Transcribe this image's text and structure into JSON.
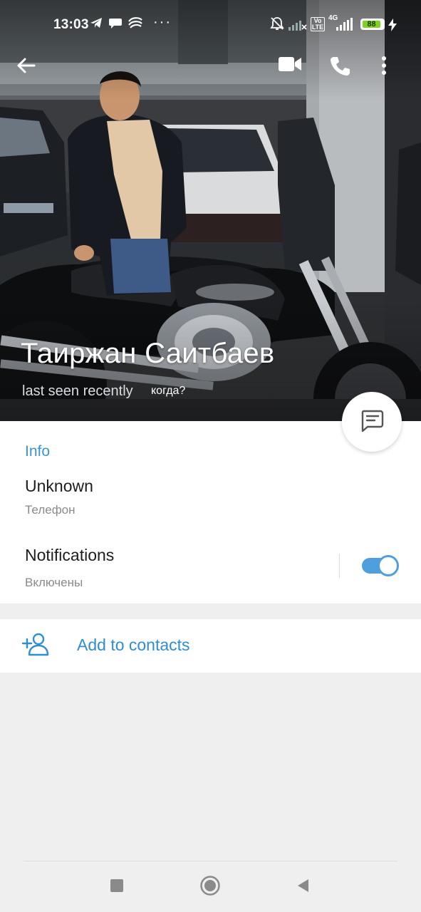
{
  "status_bar": {
    "time": "13:03",
    "battery_level": "88",
    "network_type": "4G",
    "volte": "Vo LTE",
    "icons": [
      "telegram-icon",
      "chat-bubble-icon",
      "app-icon",
      "more-dots-icon",
      "bell-muted-icon",
      "signal-icon",
      "signal-icon",
      "battery-icon",
      "charging-icon"
    ]
  },
  "app_bar": {
    "icons": [
      "back-arrow-icon",
      "video-call-icon",
      "phone-icon",
      "more-vert-icon"
    ]
  },
  "profile": {
    "name": "Таиржан Саитбаев",
    "status": "last seen recently",
    "status_hint": "когда?"
  },
  "info": {
    "section_title": "Info",
    "phone_value": "Unknown",
    "phone_label": "Телефон",
    "notifications_title": "Notifications",
    "notifications_state": "Включены",
    "notifications_enabled": true
  },
  "actions": {
    "add_contact_label": "Add to contacts"
  },
  "colors": {
    "accent": "#3a95d5",
    "toggle": "#4f9fdc",
    "background": "#efefef"
  }
}
